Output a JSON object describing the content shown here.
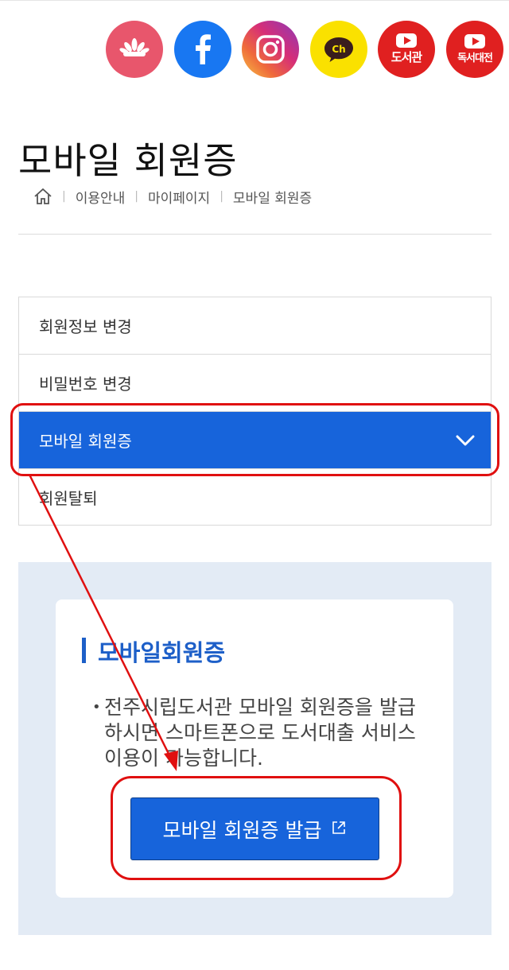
{
  "social_icons": [
    {
      "name": "blossom-logo-icon",
      "color": "#e8566c"
    },
    {
      "name": "facebook-icon",
      "color": "#1877f2"
    },
    {
      "name": "instagram-icon",
      "color": "#d62e78"
    },
    {
      "name": "kakao-channel-icon",
      "color": "#fae100",
      "text": "Ch"
    },
    {
      "name": "youtube-library-icon",
      "color": "#e02020",
      "label": "도서관"
    },
    {
      "name": "youtube-reading-icon",
      "color": "#e02020",
      "label": "독서대전"
    }
  ],
  "page": {
    "title": "모바일 회원증"
  },
  "breadcrumb": {
    "home_icon": "home-icon",
    "items": [
      "이용안내",
      "마이페이지",
      "모바일 회원증"
    ]
  },
  "menu": {
    "items": [
      {
        "label": "회원정보 변경",
        "active": false
      },
      {
        "label": "비밀번호 변경",
        "active": false
      },
      {
        "label": "모바일 회원증",
        "active": true
      },
      {
        "label": "회원탈퇴",
        "active": false
      }
    ]
  },
  "content": {
    "title": "모바일회원증",
    "description": "전주시립도서관 모바일 회원증을 발급하시면 스마트폰으로 도서대출 서비스이용이 가능합니다.",
    "button_label": "모바일 회원증 발급"
  },
  "colors": {
    "accent": "#1764db",
    "panel_bg": "#e3ebf5",
    "annotation": "#e01010"
  }
}
